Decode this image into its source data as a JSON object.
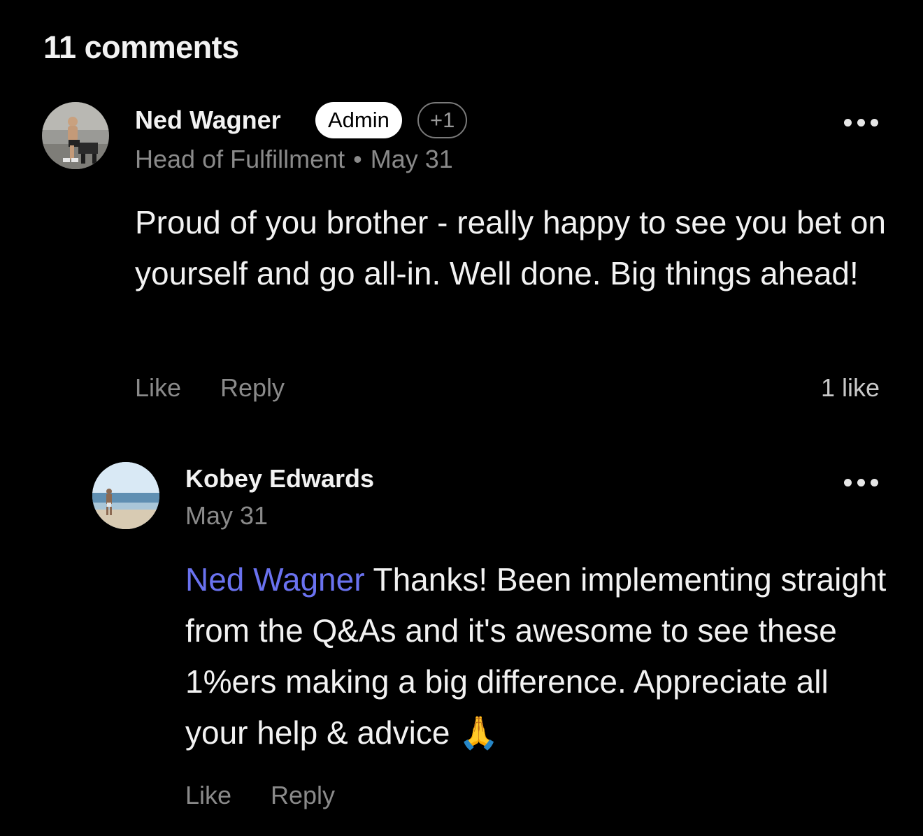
{
  "header": {
    "title": "11 comments"
  },
  "comments": [
    {
      "author": "Ned Wagner",
      "badge": "Admin",
      "extra_badge": "+1",
      "role": "Head of Fulfillment",
      "separator": "•",
      "date": "May 31",
      "text": "Proud of you brother - really happy to see you bet on yourself and go all-in. Well done. Big things ahead!",
      "like_label": "Like",
      "reply_label": "Reply",
      "likes": "1 like",
      "avatar_icon": "user-photo-gym",
      "more_icon": "more-dots-icon"
    }
  ],
  "reply": {
    "author": "Kobey Edwards",
    "date": "May 31",
    "mention": "Ned Wagner",
    "text": "Thanks! Been implementing straight from the Q&As and it's awesome to see these 1%ers making a big difference. Appreciate all your help & advice",
    "emoji": "🙏",
    "like_label": "Like",
    "reply_label": "Reply",
    "avatar_icon": "user-photo-beach",
    "more_icon": "more-dots-icon"
  },
  "colors": {
    "background": "#000000",
    "text": "#f2f2f2",
    "muted": "#8a8a8a",
    "mention": "#6a72f0",
    "badge_bg": "#ffffff"
  }
}
